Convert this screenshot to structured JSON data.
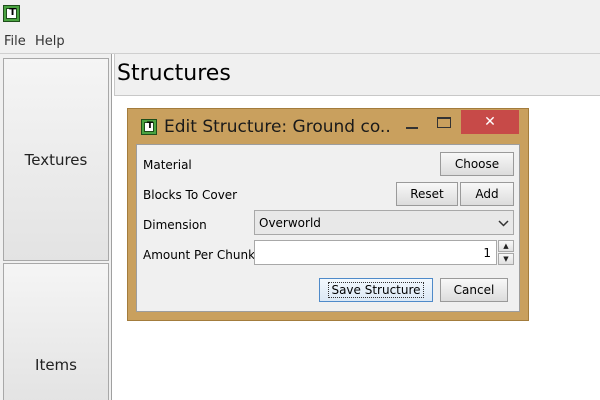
{
  "menu": {
    "file": "File",
    "help": "Help"
  },
  "sidebar": {
    "items": [
      "Textures",
      "Items"
    ]
  },
  "main": {
    "title": "Structures"
  },
  "dialog": {
    "title": "Edit Structure: Ground co...",
    "close_glyph": "✕",
    "fields": {
      "material_label": "Material",
      "choose_button": "Choose",
      "blocks_label": "Blocks To Cover",
      "reset_button": "Reset",
      "add_button": "Add",
      "dimension_label": "Dimension",
      "dimension_value": "Overworld",
      "amount_label": "Amount Per Chunk",
      "amount_value": "1"
    },
    "save_button": "Save Structure",
    "cancel_button": "Cancel"
  },
  "icons": {
    "app_icon": "app-logo-icon",
    "dropdown": "chevron-down-icon",
    "spinner_up": "triangle-up-icon",
    "spinner_down": "triangle-down-icon"
  },
  "colors": {
    "dialog_frame": "#c9a05e",
    "close_button": "#c74a48",
    "app_icon_green": "#4aa341"
  }
}
